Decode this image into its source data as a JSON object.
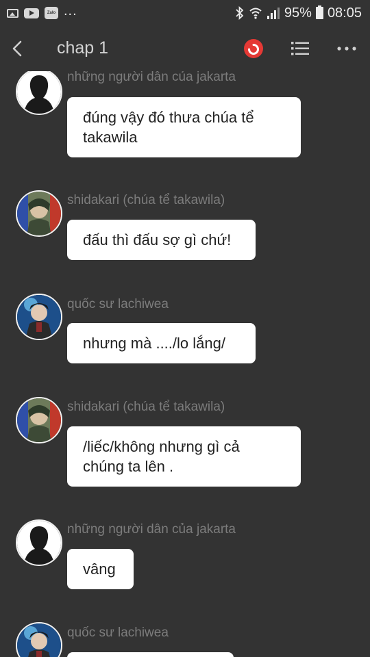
{
  "status_bar": {
    "notification_icons": [
      "gallery-icon",
      "youtube-icon",
      "zalo-icon"
    ],
    "zalo_label": "Zalo",
    "overflow": "...",
    "battery_percent": "95%",
    "time": "08:05"
  },
  "toolbar": {
    "title": "chap 1",
    "accent_color": "#e53935"
  },
  "messages": [
    {
      "sender": "những người dân của jakarta",
      "text": "đúng vậy đó thưa chúa tể\ntakawila",
      "avatar": "silhouette"
    },
    {
      "sender": "shidakari (chúa tể takawila)",
      "text": "đấu thì đấu sợ gì chứ!",
      "avatar": "shidakari"
    },
    {
      "sender": "quốc sư lachiwea",
      "text": "nhưng mà ..../lo lắng/",
      "avatar": "lachiwea"
    },
    {
      "sender": "shidakari (chúa tể takawila)",
      "text": "/liếc/không nhưng gì cả\nchúng ta lên .",
      "avatar": "shidakari"
    },
    {
      "sender": "những người dân của jakarta",
      "text": "vâng",
      "avatar": "silhouette"
    },
    {
      "sender": "quốc sư lachiwea",
      "text": "",
      "avatar": "lachiwea"
    }
  ]
}
